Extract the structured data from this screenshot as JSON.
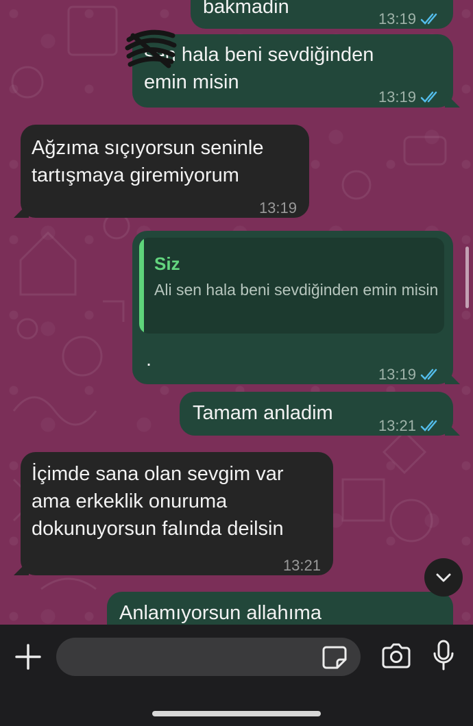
{
  "messages": [
    {
      "id": "m1",
      "direction": "outgoing",
      "text": "bakmadin",
      "time": "13:19",
      "status": "read"
    },
    {
      "id": "m2",
      "direction": "outgoing",
      "text": "sen hala beni sevdiğinden\nemin misin",
      "time": "13:19",
      "status": "read"
    },
    {
      "id": "m3",
      "direction": "incoming",
      "text": "Ağzıma sıçıyorsun seninle\ntartışmaya giremiyorum",
      "time": "13:19"
    },
    {
      "id": "m4",
      "direction": "outgoing",
      "reply_to": {
        "sender": "Siz",
        "text": "Ali sen hala beni sevdiğinden emin misin"
      },
      "text": ".",
      "time": "13:19",
      "status": "read"
    },
    {
      "id": "m5",
      "direction": "outgoing",
      "text": "Tamam anladim",
      "time": "13:21",
      "status": "read"
    },
    {
      "id": "m6",
      "direction": "incoming",
      "text": "İçimde sana olan sevgim var\nama erkeklik onuruma\ndokunuyorsun falında deilsin",
      "time": "13:21"
    },
    {
      "id": "m7",
      "direction": "outgoing",
      "text": "Anlamıyorsun allahıma",
      "time": ""
    }
  ],
  "icons": {
    "scroll_down": "chevron-down-icon",
    "attach": "plus-icon",
    "sticker": "sticker-icon",
    "camera": "camera-icon",
    "mic": "microphone-icon",
    "read_receipt": "double-check-icon"
  },
  "composer": {
    "value": "",
    "placeholder": ""
  },
  "colors": {
    "wallpaper": "#7b2f58",
    "outgoing_bubble": "#22473a",
    "incoming_bubble": "#252525",
    "read_tick": "#53bdeb",
    "quote_accent": "#5ed47a",
    "bottom_bar": "#1d1d1f"
  }
}
